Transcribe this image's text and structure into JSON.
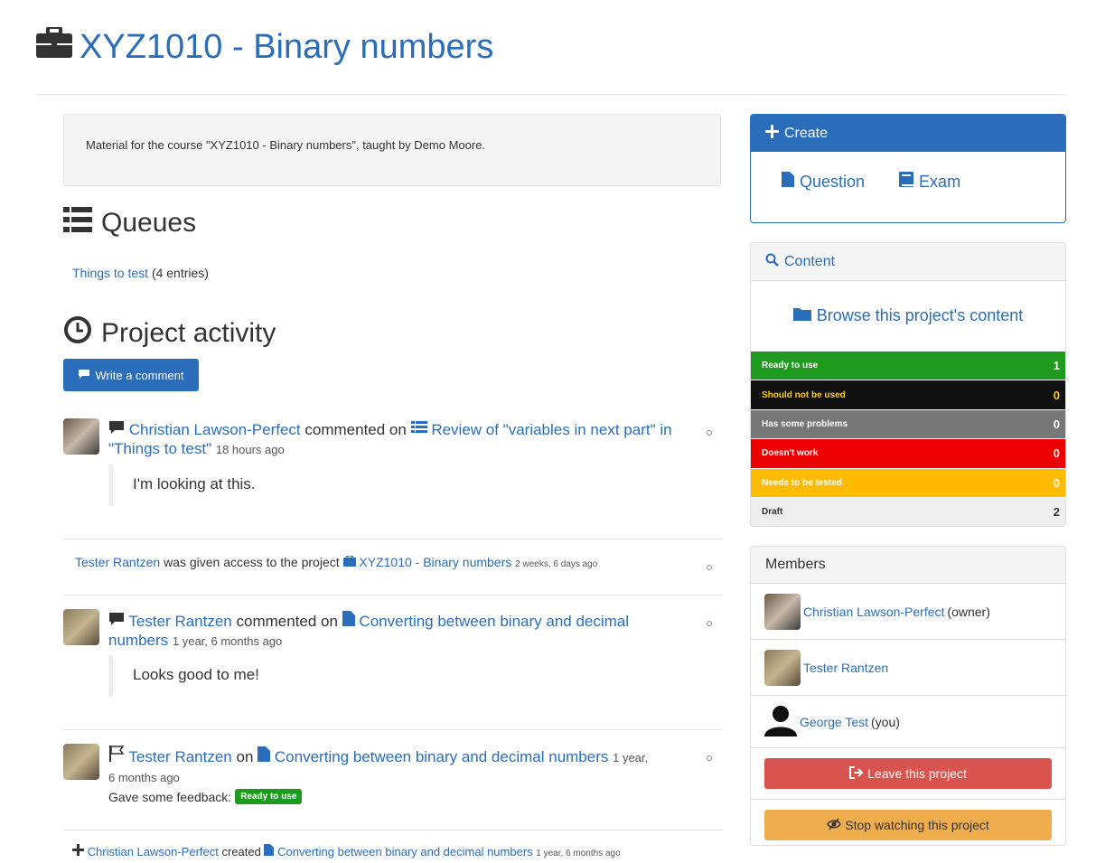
{
  "page": {
    "title": "XYZ1010 - Binary numbers",
    "description": "Material for the course \"XYZ1010 - Binary numbers\", taught by Demo Moore."
  },
  "queues": {
    "heading": "Queues",
    "link": "Things to test",
    "count": "(4 entries)"
  },
  "activity": {
    "heading": "Project activity",
    "write_comment": "Write a comment",
    "items": [
      {
        "user": "Christian Lawson-Perfect",
        "verb": "commented on",
        "target": "Review of \"variables in next part\" in \"Things to test\"",
        "time": "18 hours ago",
        "comment": "I'm looking at this."
      },
      {
        "user": "Tester Rantzen",
        "verb": "was given access to the project",
        "target": "XYZ1010 - Binary numbers",
        "time": "2 weeks, 6 days ago"
      },
      {
        "user": "Tester Rantzen",
        "verb": "commented on",
        "target": "Converting between binary and decimal numbers",
        "time": "1 year, 6 months ago",
        "comment": "Looks good to me!"
      },
      {
        "user": "Tester Rantzen",
        "verb": "on",
        "target": "Converting between binary and decimal numbers",
        "time": "1 year,",
        "time2": "6 months ago",
        "feedback_label": "Gave some feedback:",
        "feedback_badge": "Ready to use"
      },
      {
        "user": "Christian Lawson-Perfect",
        "verb": "created",
        "target": "Converting between binary and decimal numbers",
        "time": "1 year, 6 months ago"
      }
    ]
  },
  "create": {
    "heading": "Create",
    "question": "Question",
    "exam": "Exam"
  },
  "content": {
    "heading": "Content",
    "browse": "Browse this project's content",
    "stats": [
      {
        "label": "Ready to use",
        "count": "1",
        "color": "#1e9a1e"
      },
      {
        "label": "Should not be used",
        "count": "0",
        "color": "#111111"
      },
      {
        "label": "Has some problems",
        "count": "0",
        "color": "#777777"
      },
      {
        "label": "Doesn't work",
        "count": "0",
        "color": "#ee0000"
      },
      {
        "label": "Needs to be tested",
        "count": "0",
        "color": "#ffbb00"
      },
      {
        "label": "Draft",
        "count": "2",
        "color": "#eeeeee"
      }
    ]
  },
  "members": {
    "heading": "Members",
    "list": [
      {
        "name": "Christian Lawson-Perfect",
        "note": "(owner)"
      },
      {
        "name": "Tester Rantzen",
        "note": ""
      },
      {
        "name": "George Test",
        "note": "(you)"
      }
    ],
    "leave": "Leave this project",
    "stop_watching": "Stop watching this project"
  }
}
